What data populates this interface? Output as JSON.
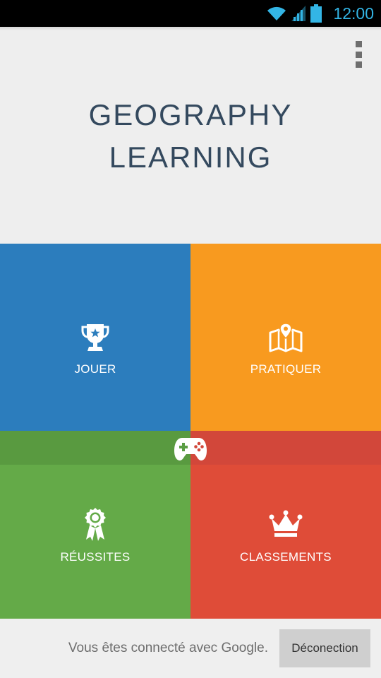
{
  "status_bar": {
    "time": "12:00",
    "icons": [
      "wifi-icon",
      "signal-icon",
      "battery-icon"
    ],
    "accent_color": "#33b5e5"
  },
  "app": {
    "title_line1": "GEOGRAPHY",
    "title_line2": "LEARNING",
    "overflow_menu_icon": "more-vert-icon"
  },
  "tiles": [
    {
      "label": "JOUER",
      "icon": "trophy-icon",
      "color": "#2c7dbd"
    },
    {
      "label": "PRATIQUER",
      "icon": "map-pin-icon",
      "color": "#f89a1f"
    },
    {
      "label": "RÉUSSITES",
      "icon": "award-ribbon-icon",
      "color": "#64aa48"
    },
    {
      "label": "CLASSEMENTS",
      "icon": "crown-icon",
      "color": "#df4c38"
    }
  ],
  "google_play_games_icon": "gamepad-icon",
  "footer": {
    "status_text": "Vous êtes connecté avec Google.",
    "signout_label": "Déconection"
  }
}
